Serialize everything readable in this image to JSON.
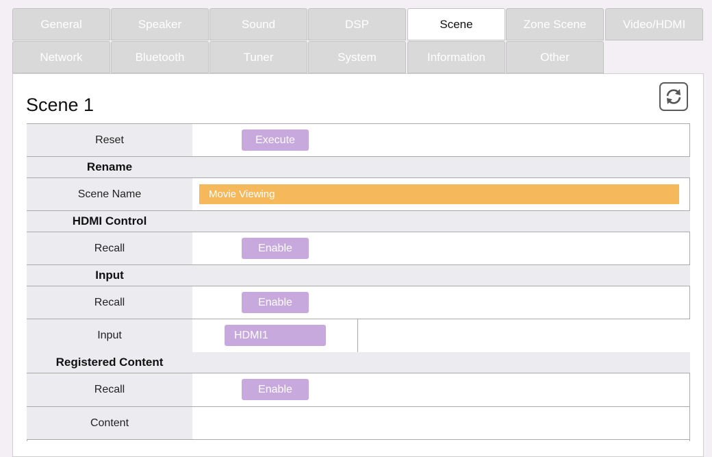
{
  "tabs": {
    "row1": [
      "General",
      "Speaker",
      "Sound",
      "DSP",
      "Scene",
      "Zone Scene",
      "Video/HDMI"
    ],
    "row2": [
      "Network",
      "Bluetooth",
      "Tuner",
      "System",
      "Information",
      "Other"
    ],
    "active": "Scene"
  },
  "page": {
    "title": "Scene 1"
  },
  "reset": {
    "label": "Reset",
    "button": "Execute"
  },
  "rename": {
    "heading": "Rename",
    "scene_name_label": "Scene Name",
    "scene_name_value": "Movie Viewing"
  },
  "hdmi_control": {
    "heading": "HDMI Control",
    "recall_label": "Recall",
    "recall_button": "Enable"
  },
  "input": {
    "heading": "Input",
    "recall_label": "Recall",
    "recall_button": "Enable",
    "input_label": "Input",
    "input_value": "HDMI1"
  },
  "registered_content": {
    "heading": "Registered Content",
    "recall_label": "Recall",
    "recall_button": "Enable",
    "content_label": "Content",
    "content_value": ""
  },
  "icons": {
    "refresh": "refresh-icon"
  },
  "colors": {
    "button": "#c8a9dd",
    "name_field": "#f5b95c",
    "tab_inactive": "#d9d9d9"
  }
}
